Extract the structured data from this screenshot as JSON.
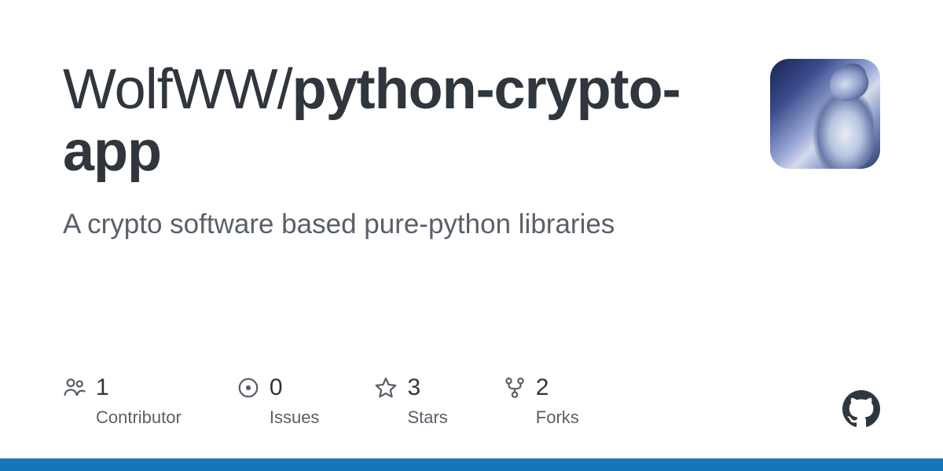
{
  "repo": {
    "owner": "WolfWW",
    "separator": "/",
    "name": "python-crypto-app",
    "description": "A crypto software based pure-python libraries"
  },
  "stats": {
    "contributors": {
      "count": "1",
      "label": "Contributor"
    },
    "issues": {
      "count": "0",
      "label": "Issues"
    },
    "stars": {
      "count": "3",
      "label": "Stars"
    },
    "forks": {
      "count": "2",
      "label": "Forks"
    }
  }
}
